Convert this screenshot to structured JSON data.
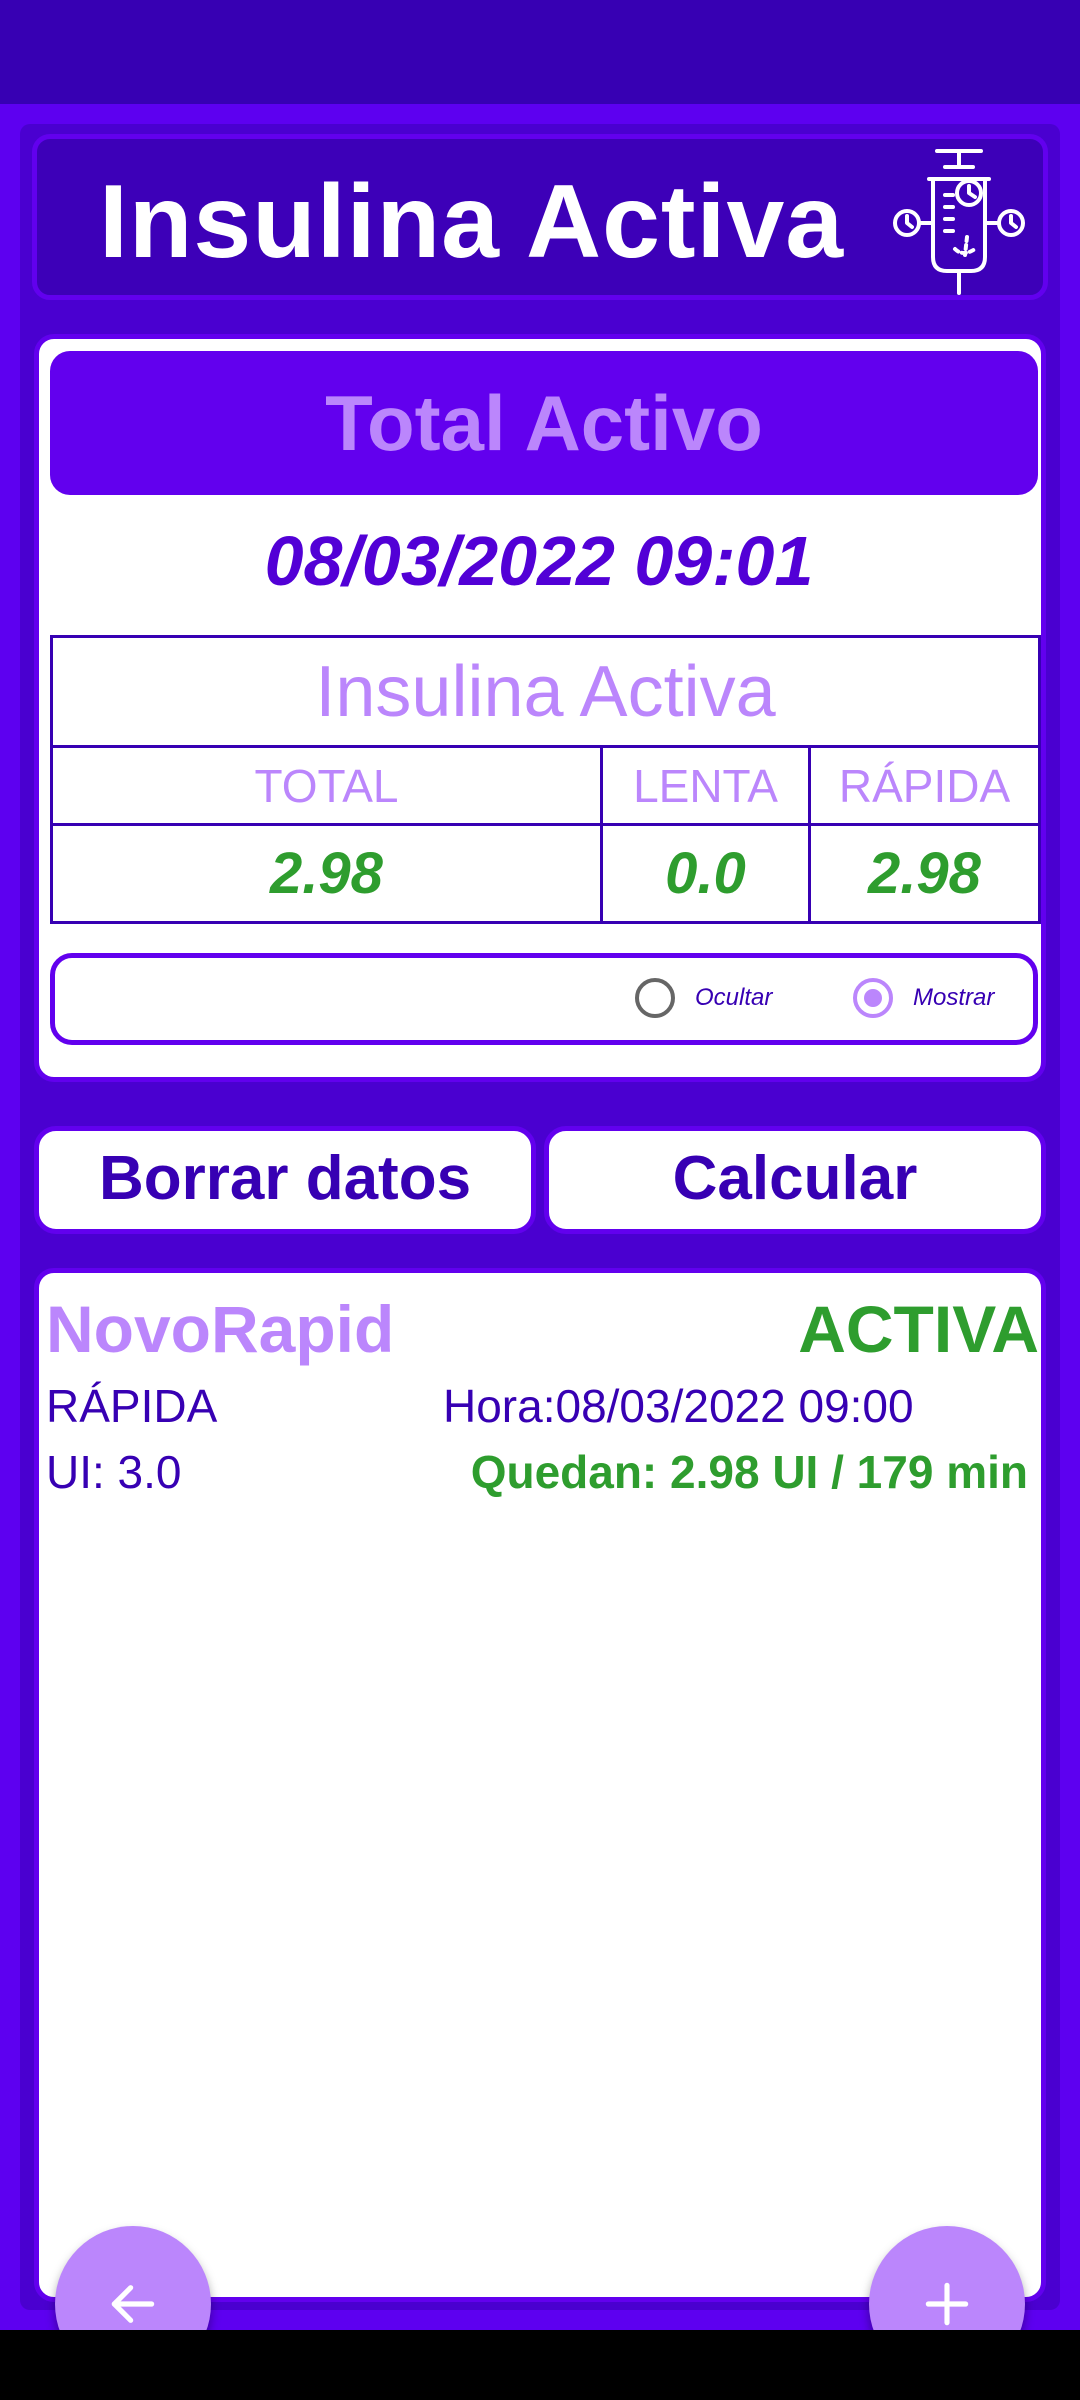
{
  "header": {
    "title": "Insulina Activa",
    "icon": "syringe-clock-icon"
  },
  "summary": {
    "banner": "Total Activo",
    "datetime": "08/03/2022 09:01",
    "table_title": "Insulina Activa",
    "columns": [
      "TOTAL",
      "LENTA",
      "RÁPIDA"
    ],
    "values": [
      "2.98",
      "0.0",
      "2.98"
    ]
  },
  "toggle": {
    "hide_label": "Ocultar",
    "show_label": "Mostrar",
    "selected": "Mostrar"
  },
  "actions": {
    "clear_label": "Borrar datos",
    "calculate_label": "Calcular"
  },
  "doses": [
    {
      "name": "NovoRapid",
      "status": "ACTIVA",
      "type": "RÁPIDA",
      "hour": "Hora:08/03/2022 09:00",
      "ui": "UI: 3.0",
      "remaining": "Quedan: 2.98 UI / 179 min"
    }
  ],
  "fabs": {
    "back_icon": "arrow-left-icon",
    "add_icon": "plus-icon"
  },
  "colors": {
    "primary": "#6200ee",
    "primary_dark": "#3700b3",
    "accent": "#bb86fc",
    "active_green": "#2e9d2e"
  }
}
